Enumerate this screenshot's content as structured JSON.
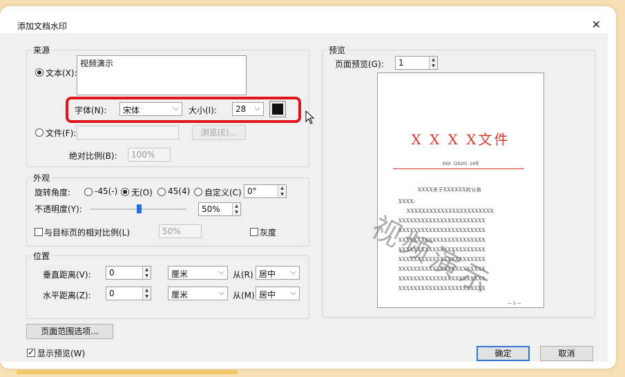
{
  "dialog": {
    "title": "添加文档水印"
  },
  "source": {
    "group_label": "来源",
    "text_radio_label": "文本(X):",
    "text_value": "视频演示",
    "font_label": "字体(N):",
    "font_value": "宋体",
    "size_label": "大小(I):",
    "size_value": "28",
    "color_value": "#111111",
    "file_radio_label": "文件(F):",
    "browse_button": "浏览(E)...",
    "abs_scale_label": "绝对比例(B):",
    "abs_scale_value": "100%"
  },
  "appearance": {
    "group_label": "外观",
    "rotation_label": "旋转角度:",
    "rotation_options": [
      "-45(-)",
      "无(O)",
      "45(4)",
      "自定义(C)"
    ],
    "rotation_selected": "无(O)",
    "rotation_custom_value": "0°",
    "opacity_label": "不透明度(Y):",
    "opacity_value": "50%",
    "opacity_fraction": 0.5,
    "relative_scale_label": "与目标页的相对比例(L)",
    "relative_scale_value": "50%",
    "grayscale_label": "灰度"
  },
  "position": {
    "group_label": "位置",
    "vertical_label": "垂直距离(V):",
    "vertical_value": "0",
    "vertical_unit": "厘米",
    "vertical_from_label": "从(R)",
    "vertical_from_value": "居中",
    "horizontal_label": "水平距离(Z):",
    "horizontal_value": "0",
    "horizontal_unit": "厘米",
    "horizontal_from_label": "从(M)",
    "horizontal_from_value": "居中"
  },
  "preview": {
    "group_label": "预览",
    "page_preview_label": "页面预览(G):",
    "page_preview_value": "1",
    "doc_title": "X X X X文件",
    "doc_subtitle": "XXX〔2020〕14号",
    "doc_heading": "XXXX关于XXXXXX的公告",
    "doc_line_short": "XXXX:",
    "doc_line": "XXXXXXXXXXXXXXXXXXXXXXX",
    "doc_page_num": "— 1 —",
    "watermark_text": "视频演示"
  },
  "footer": {
    "page_range_button": "页面范围选项...",
    "show_preview_label": "显示预览(W)",
    "ok_button": "确定",
    "cancel_button": "取消"
  }
}
